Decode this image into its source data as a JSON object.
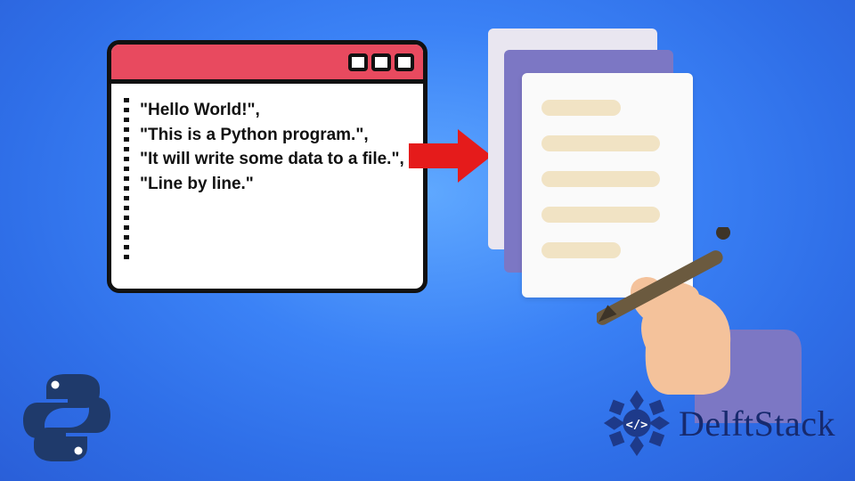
{
  "terminal": {
    "lines": [
      "\"Hello World!\",",
      "\"This is a Python program.\",",
      "\"It will write some data to a file.\",",
      "\"Line by line.\""
    ]
  },
  "brand": {
    "name": "DelftStack"
  },
  "colors": {
    "accent_red": "#e84a5f",
    "arrow_red": "#e51b1b",
    "doc_purple": "#7c77c4",
    "doc_line": "#f1e3c4",
    "brand_navy": "#172a6e"
  },
  "icons": {
    "python": "python-logo-icon",
    "brand_mark": "delftstack-logo-icon",
    "arrow": "arrow-right-icon",
    "hand_pen": "hand-writing-icon",
    "documents": "document-stack-icon"
  }
}
